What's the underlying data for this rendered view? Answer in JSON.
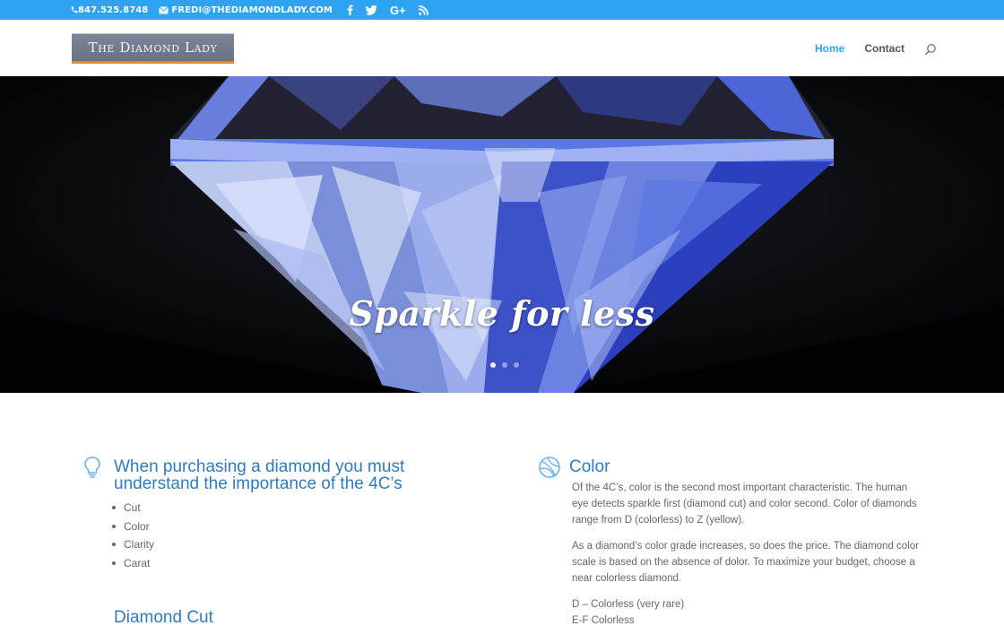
{
  "topbar": {
    "phone": "847.525.8748",
    "email": "FREDI@THEDIAMONDLADY.COM",
    "social": [
      "facebook-icon",
      "twitter-icon",
      "google-plus-icon",
      "rss-icon"
    ],
    "bg_color": "#2ea3f2"
  },
  "header": {
    "logo_text": "The Diamond Lady",
    "nav": [
      {
        "label": "Home",
        "active": true
      },
      {
        "label": "Contact",
        "active": false
      }
    ],
    "accent_color": "#2ea3f2"
  },
  "hero": {
    "title": "Sparkle for less",
    "slides": 3,
    "active_slide": 1
  },
  "left": {
    "title": "When purchasing a diamond you must understand the importance of the 4C’s",
    "items": [
      "Cut",
      "Color",
      "Clarity",
      "Carat"
    ],
    "next_title": "Diamond Cut"
  },
  "right": {
    "title": "Color",
    "paragraphs": [
      "Of the 4C’s, color is the second most important characteristic. The human eye detects sparkle first (diamond cut) and color second. Color of diamonds range from D (colorless) to Z (yellow).",
      "As a diamond’s color grade increases, so does the price. The diamond color scale is based on the absence of dolor. To maximize your budget, choose a near colorless diamond."
    ],
    "grades": [
      "D – Colorless (very rare)",
      "E-F Colorless"
    ]
  }
}
